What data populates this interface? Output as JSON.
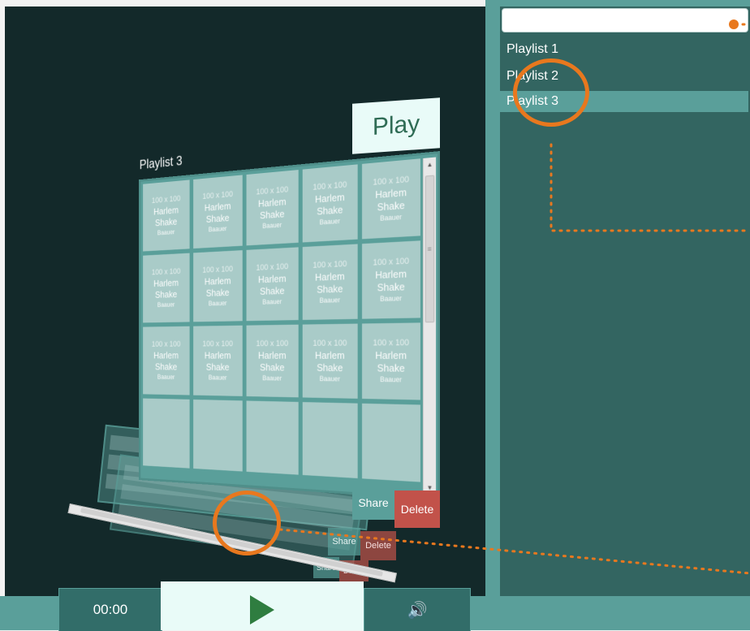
{
  "colors": {
    "stage_bg": "#13292a",
    "panel_teal": "#5a9f9a",
    "panel_dark": "#336561",
    "tile": "#a9cbc8",
    "play_bg": "#e9fbf8",
    "play_green": "#2f7d40",
    "delete_red": "#c2524a",
    "annotation_orange": "#e8781e"
  },
  "search": {
    "value": "",
    "placeholder": ""
  },
  "playlists": [
    {
      "label": "Playlist 1",
      "active": false
    },
    {
      "label": "Playlist 2",
      "active": false
    },
    {
      "label": "Playlist 3",
      "active": true
    }
  ],
  "board": {
    "title": "Playlist 3",
    "play_label": "Play",
    "share_label": "Share",
    "delete_label": "Delete",
    "tiles": [
      {
        "dim": "100 x 100",
        "song": "Harlem Shake",
        "artist": "Baauer"
      },
      {
        "dim": "100 x 100",
        "song": "Harlem Shake",
        "artist": "Baauer"
      },
      {
        "dim": "100 x 100",
        "song": "Harlem Shake",
        "artist": "Baauer"
      },
      {
        "dim": "100 x 100",
        "song": "Harlem Shake",
        "artist": "Baauer"
      },
      {
        "dim": "100 x 100",
        "song": "Harlem Shake",
        "artist": "Baauer"
      },
      {
        "dim": "100 x 100",
        "song": "Harlem Shake",
        "artist": "Baauer"
      },
      {
        "dim": "100 x 100",
        "song": "Harlem Shake",
        "artist": "Baauer"
      },
      {
        "dim": "100 x 100",
        "song": "Harlem Shake",
        "artist": "Baauer"
      },
      {
        "dim": "100 x 100",
        "song": "Harlem Shake",
        "artist": "Baauer"
      },
      {
        "dim": "100 x 100",
        "song": "Harlem Shake",
        "artist": "Baauer"
      },
      {
        "dim": "100 x 100",
        "song": "Harlem Shake",
        "artist": "Baauer"
      },
      {
        "dim": "100 x 100",
        "song": "Harlem Shake",
        "artist": "Baauer"
      },
      {
        "dim": "100 x 100",
        "song": "Harlem Shake",
        "artist": "Baauer"
      },
      {
        "dim": "100 x 100",
        "song": "Harlem Shake",
        "artist": "Baauer"
      },
      {
        "dim": "100 x 100",
        "song": "Harlem Shake",
        "artist": "Baauer"
      },
      {
        "dim": "",
        "song": "",
        "artist": ""
      },
      {
        "dim": "",
        "song": "",
        "artist": ""
      },
      {
        "dim": "",
        "song": "",
        "artist": ""
      },
      {
        "dim": "",
        "song": "",
        "artist": ""
      },
      {
        "dim": "",
        "song": "",
        "artist": ""
      }
    ]
  },
  "ghost_boards": [
    {
      "share_label": "Share",
      "delete_label": "Delete"
    },
    {
      "share_label": "Share",
      "delete_label": "Delete"
    }
  ],
  "player": {
    "time": "00:00",
    "play_icon": "play-triangle-icon",
    "volume_icon": "speaker-icon",
    "volume_glyph": "🔊"
  }
}
